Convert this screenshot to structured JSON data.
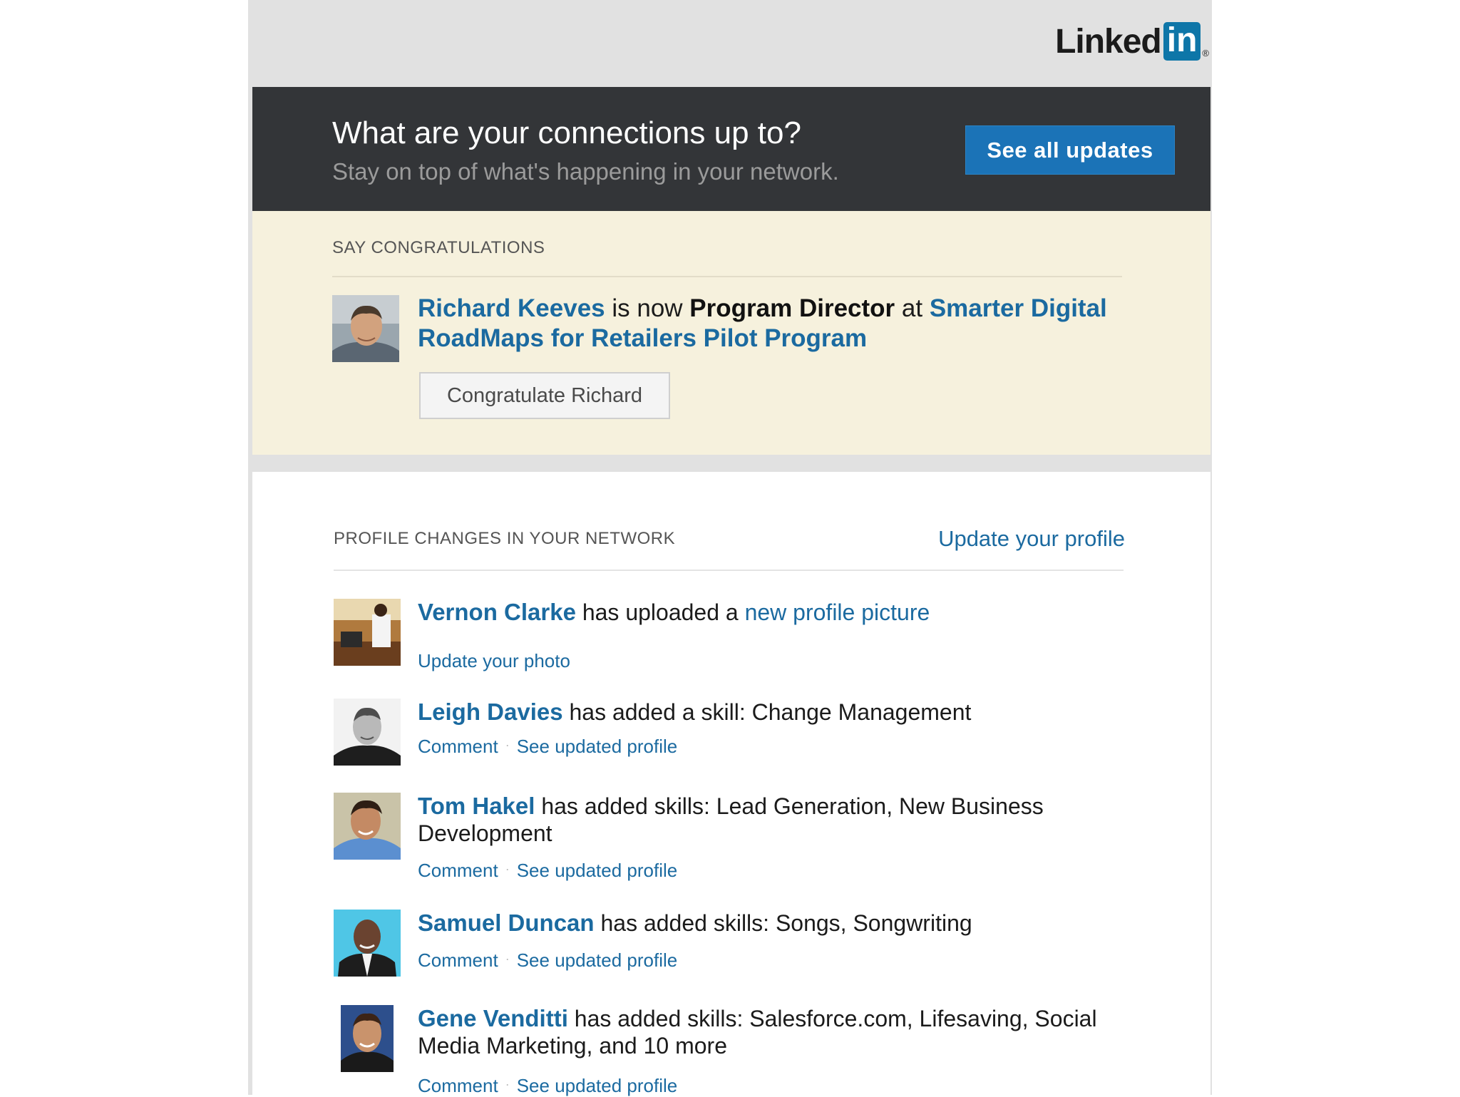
{
  "brand": {
    "logo_text": "Linked",
    "logo_in": "in",
    "logo_reg": "®",
    "color": "#0e76a8"
  },
  "hero": {
    "title": "What are your connections up to?",
    "subtitle": "Stay on top of what's happening in your network.",
    "button_label": "See all updates"
  },
  "congrats": {
    "section_label": "SAY CONGRATULATIONS",
    "person_name": "Richard Keeves",
    "text_is_now": " is now ",
    "title": "Program Director",
    "text_at": " at ",
    "organization": "Smarter Digital RoadMaps for Retailers Pilot Program",
    "button_label": "Congratulate Richard"
  },
  "profile_changes": {
    "section_label": "PROFILE CHANGES IN YOUR NETWORK",
    "update_profile_link": "Update your profile",
    "items": [
      {
        "name": "Vernon Clarke",
        "text": " has uploaded a ",
        "link": "new profile picture",
        "action_1": "Update your photo"
      },
      {
        "name": "Leigh Davies",
        "text": " has added a skill: Change Management",
        "action_1": "Comment",
        "action_2": "See updated profile"
      },
      {
        "name": "Tom Hakel",
        "text": " has added skills: Lead Generation, New Business Development",
        "action_1": "Comment",
        "action_2": "See updated profile"
      },
      {
        "name": "Samuel Duncan",
        "text": " has added skills: Songs, Songwriting",
        "action_1": "Comment",
        "action_2": "See updated profile"
      },
      {
        "name": "Gene Venditti",
        "text": " has added skills: Salesforce.com, Lifesaving, Social Media Marketing, and 10 more",
        "action_1": "Comment",
        "action_2": "See updated profile"
      }
    ]
  },
  "separator": "·"
}
